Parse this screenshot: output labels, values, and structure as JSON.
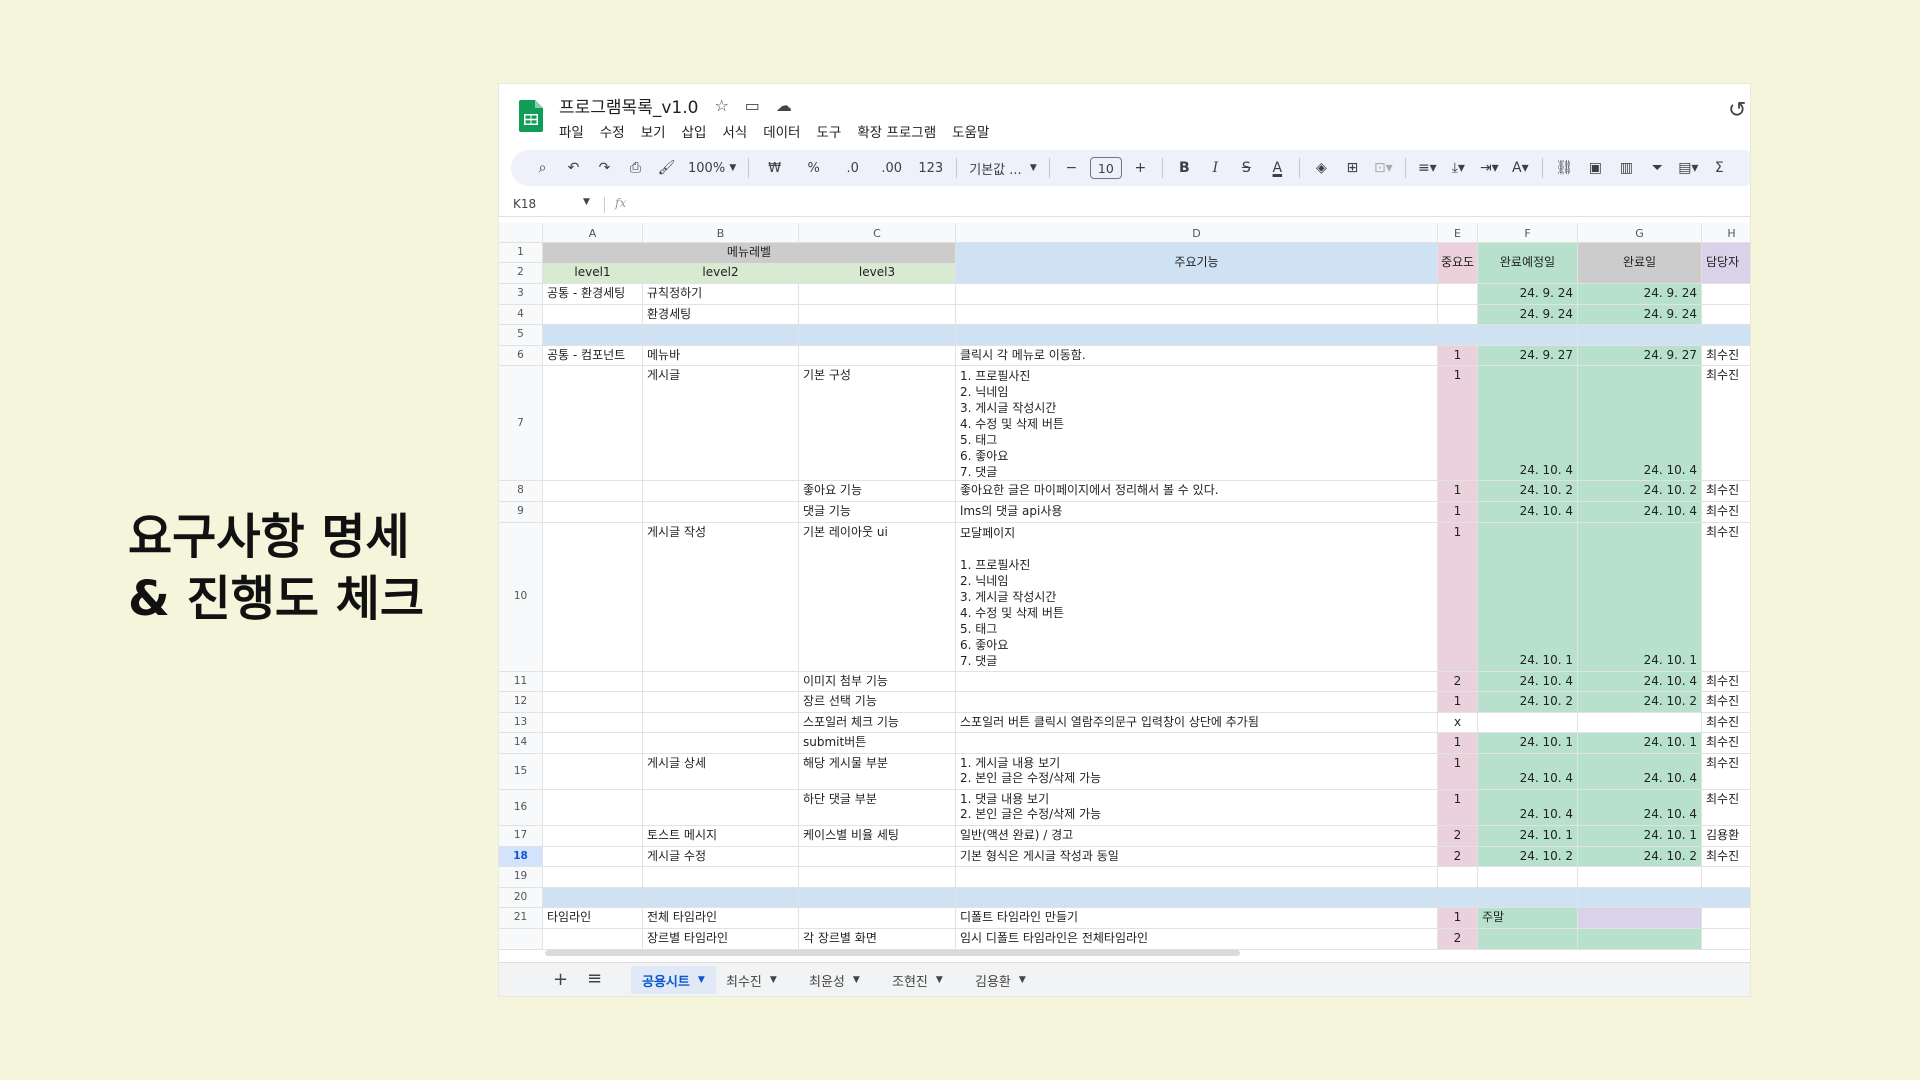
{
  "slide": {
    "title_line1": "요구사항 명세",
    "title_line2": "& 진행도 체크"
  },
  "doc": {
    "title": "프로그램목록_v1.0"
  },
  "menu": [
    "파일",
    "수정",
    "보기",
    "삽입",
    "서식",
    "데이터",
    "도구",
    "확장 프로그램",
    "도움말"
  ],
  "toolbar": {
    "zoom": "100%",
    "currency": "₩",
    "percent": "%",
    "dec_less": ".0",
    "dec_more": ".00",
    "number_fmt": "123",
    "font": "기본값 ...",
    "font_size": "10"
  },
  "formula": {
    "cell_ref": "K18",
    "fx": "fx"
  },
  "columns": [
    "A",
    "B",
    "C",
    "D",
    "E",
    "F",
    "G",
    "H"
  ],
  "header": {
    "menu_level": "메뉴레벨",
    "level1": "level1",
    "level2": "level2",
    "level3": "level3",
    "main_feature": "주요기능",
    "importance": "중요도",
    "planned_date": "완료예정일",
    "done_date": "완료일",
    "owner": "담당자"
  },
  "rows": [
    {
      "n": "3",
      "a": "공통 - 환경세팅",
      "b": "규칙정하기",
      "c": "",
      "d": "",
      "e": "",
      "f": "24. 9. 24",
      "g": "24. 9. 24",
      "h": ""
    },
    {
      "n": "4",
      "a": "",
      "b": "환경세팅",
      "c": "",
      "d": "",
      "e": "",
      "f": "24. 9. 24",
      "g": "24. 9. 24",
      "h": ""
    },
    {
      "n": "5",
      "a": "",
      "b": "",
      "c": "",
      "d": "",
      "e": "",
      "f": "",
      "g": "",
      "h": ""
    },
    {
      "n": "6",
      "a": "공통 - 컴포넌트",
      "b": "메뉴바",
      "c": "",
      "d": "클릭시 각 메뉴로 이동함.",
      "e": "1",
      "f": "24. 9. 27",
      "g": "24. 9. 27",
      "h": "최수진"
    },
    {
      "n": "7",
      "a": "",
      "b": "게시글",
      "c": "기본 구성",
      "d": "1. 프로필사진\n2. 닉네임\n3. 게시글 작성시간\n4. 수정 및 삭제 버튼\n5. 태그\n6. 좋아요\n7. 댓글",
      "e": "1",
      "f": "24. 10. 4",
      "g": "24. 10. 4",
      "h": "최수진"
    },
    {
      "n": "8",
      "a": "",
      "b": "",
      "c": "좋아요 기능",
      "d": "좋아요한 글은 마이페이지에서 정리해서 볼 수 있다.",
      "e": "1",
      "f": "24. 10. 2",
      "g": "24. 10. 2",
      "h": "최수진"
    },
    {
      "n": "9",
      "a": "",
      "b": "",
      "c": "댓글 기능",
      "d": "lms의 댓글 api사용",
      "e": "1",
      "f": "24. 10. 4",
      "g": "24. 10. 4",
      "h": "최수진"
    },
    {
      "n": "10",
      "a": "",
      "b": "게시글 작성",
      "c": "기본 레이아웃 ui",
      "d": "모달페이지\n\n1. 프로필사진\n2. 닉네임\n3. 게시글 작성시간\n4. 수정 및 삭제 버튼\n5. 태그\n6. 좋아요\n7. 댓글",
      "e": "1",
      "f": "24. 10. 1",
      "g": "24. 10. 1",
      "h": "최수진"
    },
    {
      "n": "11",
      "a": "",
      "b": "",
      "c": "이미지 첨부 기능",
      "d": "",
      "e": "2",
      "f": "24. 10. 4",
      "g": "24. 10. 4",
      "h": "최수진"
    },
    {
      "n": "12",
      "a": "",
      "b": "",
      "c": "장르 선택 기능",
      "d": "",
      "e": "1",
      "f": "24. 10. 2",
      "g": "24. 10. 2",
      "h": "최수진"
    },
    {
      "n": "13",
      "a": "",
      "b": "",
      "c": "스포일러 체크 기능",
      "d": "스포일러 버튼 클릭시 열람주의문구 입력창이 상단에 추가됨",
      "e": "x",
      "f": "",
      "g": "",
      "h": "최수진"
    },
    {
      "n": "14",
      "a": "",
      "b": "",
      "c": "submit버튼",
      "d": "",
      "e": "1",
      "f": "24. 10. 1",
      "g": "24. 10. 1",
      "h": "최수진"
    },
    {
      "n": "15",
      "a": "",
      "b": "게시글 상세",
      "c": "해당 게시물 부분",
      "d": "1. 게시글 내용 보기\n2. 본인 글은 수정/삭제 가능",
      "e": "1",
      "f": "24. 10. 4",
      "g": "24. 10. 4",
      "h": "최수진"
    },
    {
      "n": "16",
      "a": "",
      "b": "",
      "c": "하단 댓글 부분",
      "d": "1. 댓글 내용 보기\n2. 본인 글은 수정/삭제 가능",
      "e": "1",
      "f": "24. 10. 4",
      "g": "24. 10. 4",
      "h": "최수진"
    },
    {
      "n": "17",
      "a": "",
      "b": "토스트 메시지",
      "c": "케이스별 비율 세팅",
      "d": "일반(액션 완료) / 경고",
      "e": "2",
      "f": "24. 10. 1",
      "g": "24. 10. 1",
      "h": "김용환"
    },
    {
      "n": "18",
      "a": "",
      "b": "게시글 수정",
      "c": "",
      "d": "기본 형식은 게시글 작성과 동일",
      "e": "2",
      "f": "24. 10. 2",
      "g": "24. 10. 2",
      "h": "최수진"
    },
    {
      "n": "19",
      "a": "",
      "b": "",
      "c": "",
      "d": "",
      "e": "",
      "f": "",
      "g": "",
      "h": ""
    },
    {
      "n": "20",
      "a": "",
      "b": "",
      "c": "",
      "d": "",
      "e": "",
      "f": "",
      "g": "",
      "h": ""
    },
    {
      "n": "21",
      "a": "타임라인",
      "b": "전체 타임라인",
      "c": "",
      "d": "디폴트 타임라인 만들기",
      "e": "1",
      "f": "주말",
      "g": "",
      "h": ""
    },
    {
      "n": "",
      "a": "",
      "b": "장르별 타임라인",
      "c": "각 장르별 화면",
      "d": "임시 디폴트 타임라인은 전체타임라인",
      "e": "2",
      "f": "",
      "g": "",
      "h": ""
    }
  ],
  "tabs": [
    "공용시트",
    "최수진",
    "최윤성",
    "조현진",
    "김용환"
  ],
  "colors": {
    "slide_bg": "#f5f5dc",
    "importance": "#ead1dc",
    "done": "#b7e1cd",
    "section": "#cfe2f3",
    "accent": "#0b57d0"
  }
}
